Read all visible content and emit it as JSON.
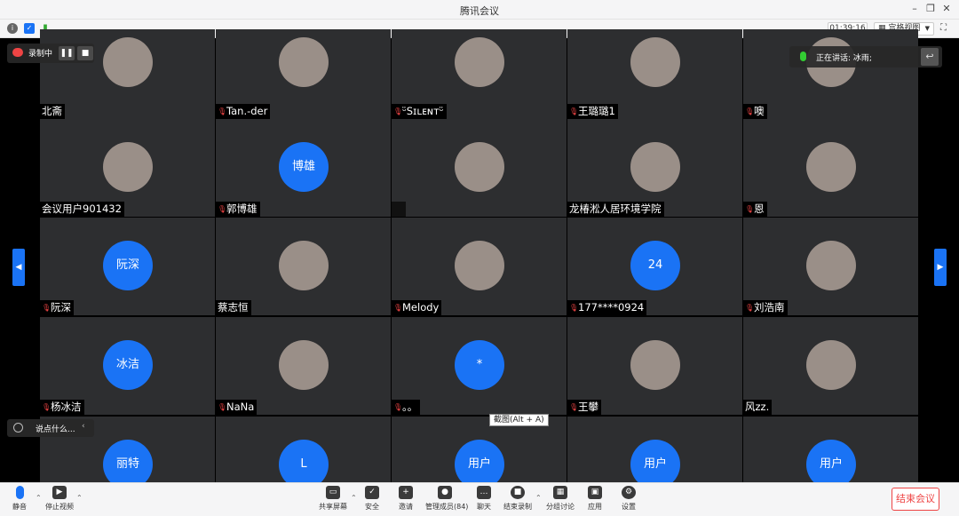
{
  "window": {
    "title": "腾讯会议"
  },
  "toolbar": {
    "timer": "01:39:16",
    "view_label": "宫格视图"
  },
  "recording": {
    "label": "录制中"
  },
  "speaking": {
    "label": "正在讲话: 冰雨;"
  },
  "chat": {
    "placeholder": "说点什么..."
  },
  "tooltip": "截图(Alt + A)",
  "tiles": [
    {
      "name": "北斋",
      "avatar_text": "",
      "photo": true,
      "muted": false
    },
    {
      "name": "Tan.-der",
      "avatar_text": "",
      "photo": true,
      "muted": true
    },
    {
      "name": "ᵕ̈Sɪʟᴇɴᴛᵕ̈",
      "avatar_text": "",
      "photo": true,
      "muted": true
    },
    {
      "name": "王璐璐1",
      "avatar_text": "",
      "photo": true,
      "muted": true
    },
    {
      "name": "噢",
      "avatar_text": "",
      "photo": true,
      "muted": true
    },
    {
      "name": "会议用户901432",
      "avatar_text": "",
      "photo": true,
      "muted": false
    },
    {
      "name": "郭博雄",
      "avatar_text": "博雄",
      "photo": false,
      "muted": true
    },
    {
      "name": "",
      "avatar_text": "",
      "photo": true,
      "muted": false
    },
    {
      "name": "龙椿淞人居环境学院",
      "avatar_text": "",
      "photo": true,
      "muted": false
    },
    {
      "name": "恩",
      "avatar_text": "",
      "photo": true,
      "muted": true
    },
    {
      "name": "阮深",
      "avatar_text": "阮深",
      "photo": false,
      "muted": true
    },
    {
      "name": "蔡志恒",
      "avatar_text": "",
      "photo": true,
      "muted": false
    },
    {
      "name": "Melody",
      "avatar_text": "",
      "photo": true,
      "muted": true
    },
    {
      "name": "177****0924",
      "avatar_text": "24",
      "photo": false,
      "muted": true
    },
    {
      "name": "刘浩南",
      "avatar_text": "",
      "photo": true,
      "muted": true
    },
    {
      "name": "杨冰洁",
      "avatar_text": "冰洁",
      "photo": false,
      "muted": true
    },
    {
      "name": "NaNa",
      "avatar_text": "",
      "photo": true,
      "muted": true
    },
    {
      "name": "。。",
      "avatar_text": "*",
      "photo": false,
      "muted": true
    },
    {
      "name": "王攀",
      "avatar_text": "",
      "photo": true,
      "muted": true
    },
    {
      "name": "风zz.",
      "avatar_text": "",
      "photo": true,
      "muted": false
    },
    {
      "name": "",
      "avatar_text": "丽特",
      "photo": false,
      "muted": false
    },
    {
      "name": "",
      "avatar_text": "L",
      "photo": false,
      "muted": false
    },
    {
      "name": "",
      "avatar_text": "用户",
      "photo": false,
      "muted": false
    },
    {
      "name": "",
      "avatar_text": "用户",
      "photo": false,
      "muted": false
    },
    {
      "name": "",
      "avatar_text": "用户",
      "photo": false,
      "muted": false
    }
  ],
  "bottom": {
    "mute": "静音",
    "video": "停止视频",
    "share": "共享屏幕",
    "security": "安全",
    "invite": "邀请",
    "members": "管理成员(84)",
    "chat": "聊天",
    "record": "结束录制",
    "breakout": "分组讨论",
    "apps": "应用",
    "settings": "设置",
    "end": "结束会议"
  },
  "colors": {
    "accent": "#1a73f5",
    "danger": "#e44444",
    "tile": "#2d2e30"
  }
}
